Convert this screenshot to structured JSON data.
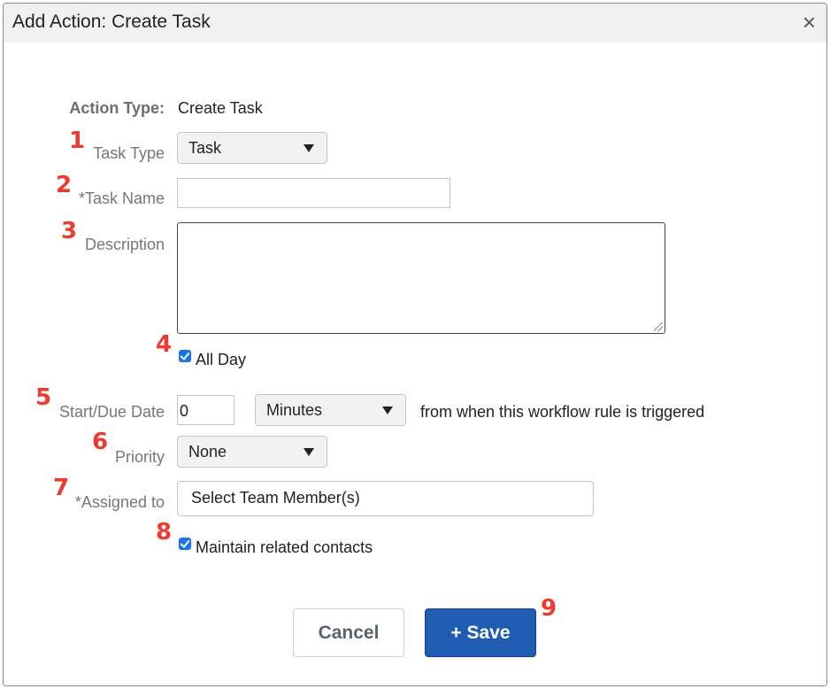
{
  "dialog": {
    "title": "Add Action: Create Task",
    "close_symbol": "×"
  },
  "form": {
    "action_type": {
      "label": "Action Type:",
      "value": "Create Task"
    },
    "task_type": {
      "label": "Task Type",
      "value": "Task"
    },
    "task_name": {
      "label": "*Task Name",
      "value": ""
    },
    "description": {
      "label": "Description",
      "value": ""
    },
    "all_day": {
      "label": "All Day",
      "checked": true
    },
    "start_due_date": {
      "label": "Start/Due Date",
      "amount": "0",
      "unit": "Minutes",
      "suffix": "from when this workflow rule is triggered"
    },
    "priority": {
      "label": "Priority",
      "value": "None"
    },
    "assigned_to": {
      "label": "*Assigned to",
      "value": "Select Team Member(s)"
    },
    "maintain_contacts": {
      "label": "Maintain related contacts",
      "checked": true
    }
  },
  "buttons": {
    "cancel": "Cancel",
    "save": "+ Save"
  },
  "annotations": [
    "1",
    "2",
    "3",
    "4",
    "5",
    "6",
    "7",
    "8",
    "9"
  ],
  "colors": {
    "save_button": "#1f5cb2",
    "annotation": "#ee3b2f",
    "checkbox": "#1a73e8"
  }
}
